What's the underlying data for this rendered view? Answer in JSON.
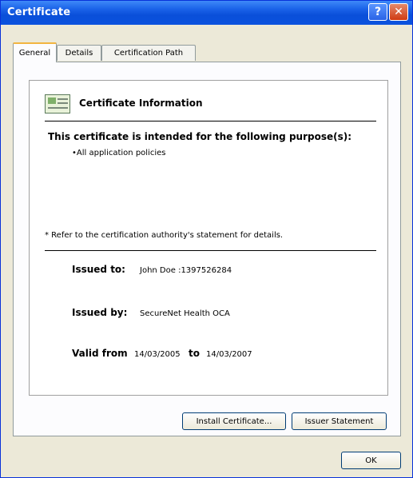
{
  "window": {
    "title": "Certificate"
  },
  "titlebar": {
    "help_glyph": "?",
    "close_glyph": "✕"
  },
  "tabs": [
    {
      "label": "General",
      "active": true
    },
    {
      "label": "Details",
      "active": false
    },
    {
      "label": "Certification Path",
      "active": false
    }
  ],
  "info": {
    "header": "Certificate Information",
    "purpose_heading": "This certificate is intended for the following purpose(s):",
    "purposes": [
      "•All application policies"
    ],
    "note": "* Refer to the certification authority's statement for details."
  },
  "fields": {
    "issued_to_label": "Issued to:",
    "issued_to_value": "John Doe :1397526284",
    "issued_by_label": "Issued by:",
    "issued_by_value": "SecureNet Health OCA",
    "valid_from_label": "Valid from",
    "valid_from_value": "14/03/2005",
    "valid_to_label": "to",
    "valid_to_value": "14/03/2007"
  },
  "buttons": {
    "install": "Install Certificate...",
    "issuer": "Issuer Statement",
    "ok": "OK"
  },
  "colors": {
    "titlebar": "#0a4fd9",
    "dialog_bg": "#ece9d8",
    "active_tab_accent": "#f2b540"
  },
  "icons": {
    "certificate": "certificate-icon",
    "help": "help-icon",
    "close": "close-icon"
  }
}
